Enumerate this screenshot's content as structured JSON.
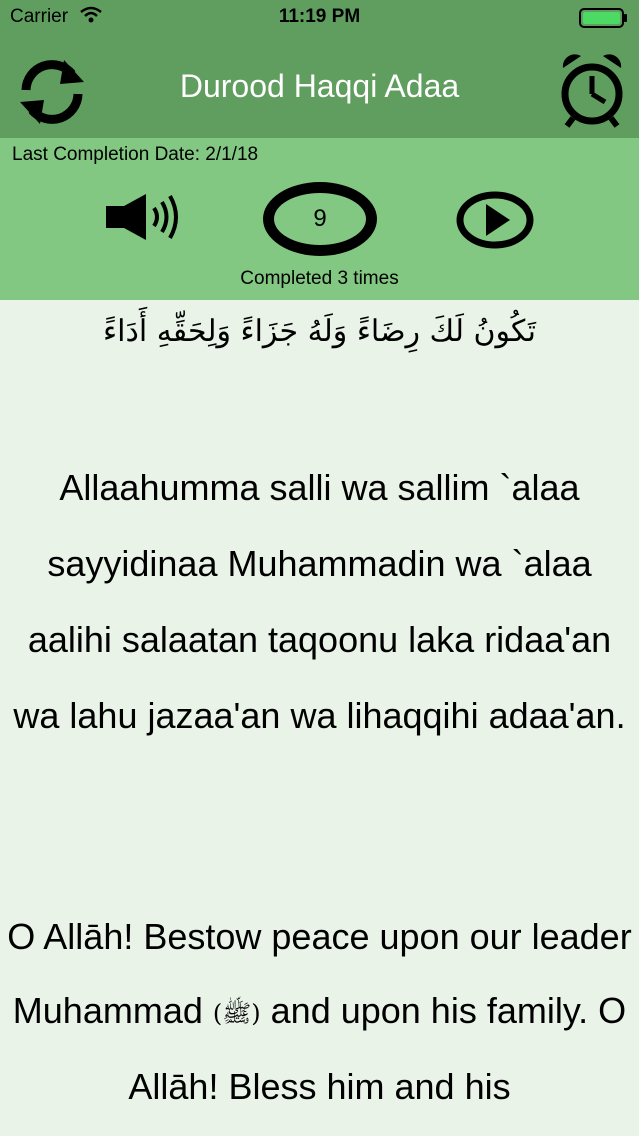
{
  "status_bar": {
    "carrier": "Carrier",
    "time": "11:19 PM",
    "battery_color": "#4cd964"
  },
  "nav": {
    "title": "Durood Haqqi Adaa",
    "left_icon": "refresh-icon",
    "right_icon": "alarm-clock-icon"
  },
  "panel": {
    "last_completion": "Last Completion Date: 2/1/18",
    "count": "9",
    "completed": "Completed 3 times"
  },
  "content": {
    "arabic": "تَكُونُ لَكَ رِضَاءً وَلَهُ جَزَاءً وَلِحَقِّهِ أَدَاءً",
    "transliteration": "Allaahumma salli wa sallim `alaa sayyidinaa Muhammadin wa `alaa aalihi salaatan taqoonu laka ridaa'an wa lahu jazaa'an wa lihaqqihi adaa'an.",
    "translation_part1": "O Allāh! Bestow peace upon our leader Muhammad",
    "salawat_symbol": "(ﷺ)",
    "translation_part2": "and upon his family. O Allāh! Bless him and his"
  },
  "colors": {
    "header_green": "#5f9e5e",
    "panel_green": "#82c782",
    "background": "#e9f3e8"
  }
}
